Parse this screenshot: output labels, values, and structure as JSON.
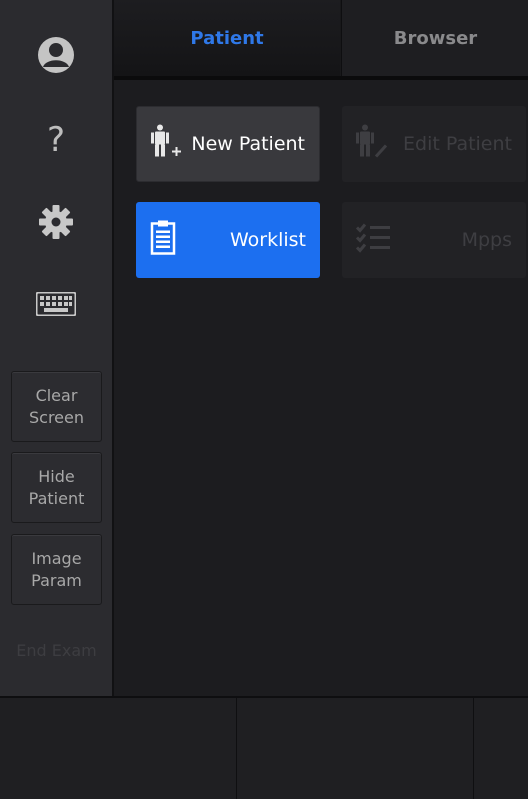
{
  "sidebar": {
    "icons": [
      {
        "name": "user-icon"
      },
      {
        "name": "help-icon",
        "glyph": "?"
      },
      {
        "name": "settings-gear-icon"
      },
      {
        "name": "keyboard-icon"
      }
    ],
    "buttons": [
      {
        "label": "Clear\nScreen",
        "enabled": true
      },
      {
        "label": "Hide\nPatient",
        "enabled": true
      },
      {
        "label": "Image\nParam",
        "enabled": true
      },
      {
        "label": "End Exam",
        "enabled": false
      }
    ]
  },
  "tabs": [
    {
      "label": "Patient",
      "active": true
    },
    {
      "label": "Browser",
      "active": false
    }
  ],
  "tiles": [
    {
      "label": "New Patient",
      "icon": "new-patient-icon",
      "state": "normal"
    },
    {
      "label": "Edit Patient",
      "icon": "edit-patient-icon",
      "state": "disabled"
    },
    {
      "label": "Worklist",
      "icon": "worklist-clipboard-icon",
      "state": "selected"
    },
    {
      "label": "Mpps",
      "icon": "checklist-icon",
      "state": "disabled"
    }
  ],
  "colors": {
    "accent": "#1c6ff0",
    "active_tab_text": "#2f78e8",
    "background": "#1c1c1f",
    "sidebar": "#2b2b2f"
  }
}
